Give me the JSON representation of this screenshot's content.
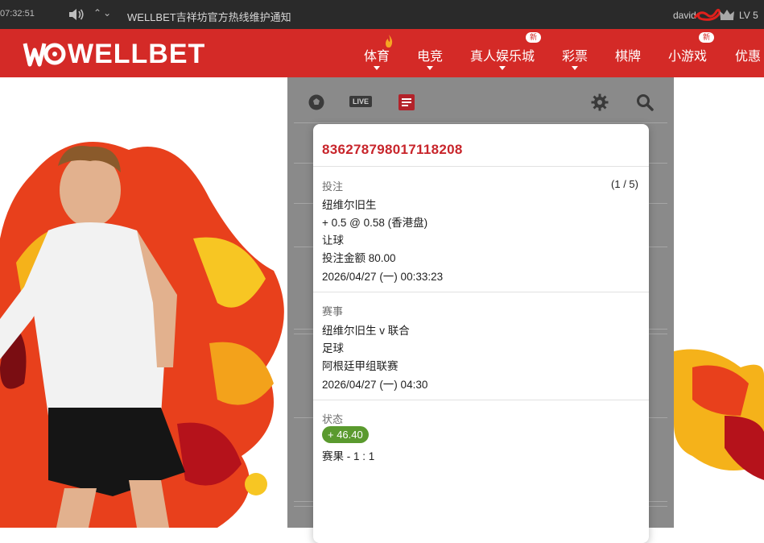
{
  "topbar": {
    "time": "07:32:51",
    "notice": "WELLBET吉祥坊官方热线维护通知",
    "username": "david",
    "level": "LV 5"
  },
  "header": {
    "brand": "WELLBET",
    "nav": [
      {
        "label": "体育"
      },
      {
        "label": "电竞"
      },
      {
        "label": "真人娱乐城",
        "badge": "新"
      },
      {
        "label": "彩票"
      },
      {
        "label": "棋牌"
      },
      {
        "label": "小游戏",
        "badge": "新"
      },
      {
        "label": "优惠"
      }
    ]
  },
  "toolbar": {
    "live_label": "LIVE"
  },
  "bet": {
    "ticket_id": "836278798017118208",
    "bet_section": {
      "label": "投注",
      "count": "(1 / 5)",
      "selection": "纽维尔旧生",
      "odds": "+ 0.5 @ 0.58 (香港盘)",
      "market": "让球",
      "stake": "投注金额 80.00",
      "placed_at": "2026/04/27 (一) 00:33:23"
    },
    "event_section": {
      "label": "赛事",
      "match": "纽维尔旧生 v 联合",
      "sport": "足球",
      "league": "阿根廷甲组联赛",
      "kickoff": "2026/04/27 (一) 04:30"
    },
    "status_section": {
      "label": "状态",
      "result_amount": "+ 46.40",
      "score": "赛果 - 1 : 1"
    }
  },
  "colors": {
    "header_red": "#d42a27",
    "ticket_red": "#c8252b",
    "win_green": "#5a9a2e",
    "panel_grey": "#8a8a8a"
  }
}
